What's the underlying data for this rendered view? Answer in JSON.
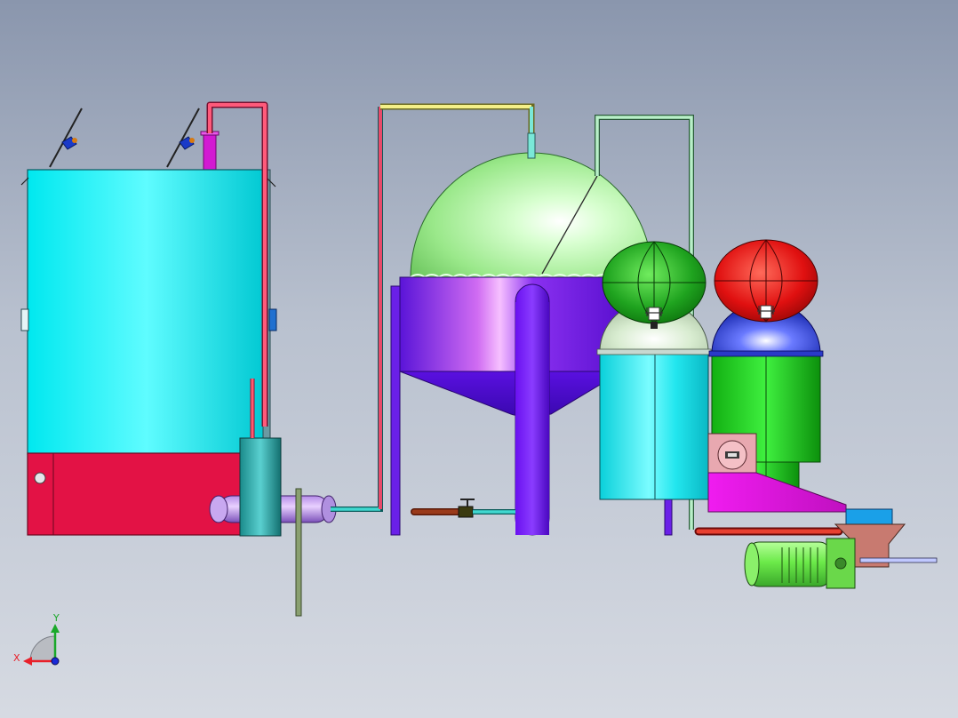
{
  "triad": {
    "x_label": "X",
    "y_label": "Y",
    "x_color": "#e8202a",
    "y_color": "#1aa82a",
    "z_color": "#1a2ad8"
  },
  "colors": {
    "background_top": "#8a96ad",
    "background_bottom": "#d6dae2",
    "left_tank_body": "#00ffff",
    "left_tank_base": "#e31245",
    "dome": "#9cf088",
    "hopper": "#7a22ee",
    "green_sphere": "#1ea31e",
    "red_sphere": "#e01010",
    "cyan_tank": "#12e0e8",
    "green_tank": "#1ed91e",
    "magenta_chute": "#f018f0",
    "motor": "#7cf04a"
  },
  "equipment": [
    "left-tank",
    "heat-exchanger",
    "dome-reactor",
    "green-sphere",
    "red-sphere",
    "cyan-tank",
    "green-tank",
    "control-box",
    "motor"
  ]
}
